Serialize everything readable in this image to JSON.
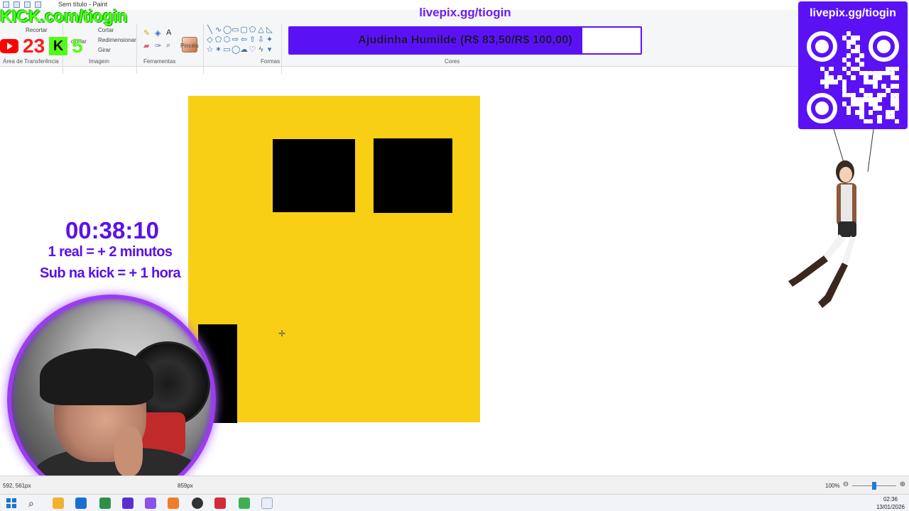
{
  "window": {
    "title": "Sem título - Paint"
  },
  "ribbon": {
    "clipboard_label": "Área de Transferência",
    "image_label": "Imagem",
    "tools_label": "Ferramentas",
    "shapes_label": "Formas",
    "colors_label": "Cores",
    "cut_label": "Cortar",
    "crop_label": "Recortar",
    "resize_label": "Redimensionar",
    "rotate_label": "Girar",
    "brushes_label": "Pincéis",
    "select_label": "cionar"
  },
  "overlay": {
    "kick_url": "KICK.com/tiogin",
    "livepix_top": "livepix.gg/tiogin",
    "youtube_count": "23",
    "kick_count": "5",
    "donation_goal_text": "Ajudinha Humilde (R$ 83,50/R$ 100,00)",
    "donation_progress": 0.835,
    "timer": "00:38:10",
    "rule_real": "1 real = + 2 minutos",
    "rule_sub": "Sub na kick = + 1 hora",
    "qr_title": "livepix.gg/tiogin"
  },
  "statusbar": {
    "cursor_position": "592, 561px",
    "canvas_size": "859px",
    "zoom": "100%"
  },
  "taskbar": {
    "time": "02:36",
    "date": "13/01/2026"
  },
  "colors": {
    "accent_purple": "#5a12f5",
    "paint_yellow": "#f8cf15",
    "kick_green": "#53fc18",
    "youtube_red": "#ff0000"
  }
}
